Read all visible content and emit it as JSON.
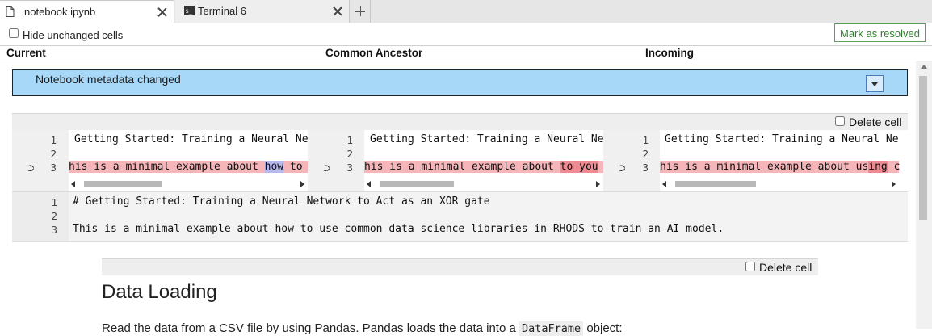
{
  "tabs": [
    {
      "label": "notebook.ipynb",
      "icon": "notebook-file-icon",
      "active": true
    },
    {
      "label": "Terminal 6",
      "icon": "terminal-icon",
      "active": false
    }
  ],
  "toolbar": {
    "hide_unchanged_label": "Hide unchanged cells",
    "mark_resolved_label": "Mark as resolved"
  },
  "columns": {
    "current": "Current",
    "ancestor": "Common Ancestor",
    "incoming": "Incoming"
  },
  "metadata_banner": {
    "text": "Notebook metadata changed"
  },
  "cell1": {
    "delete_label": "Delete cell",
    "panes": [
      {
        "line1": "Getting Started: Training a Neural Ne",
        "line3_pre": "his is a minimal example about ",
        "line3_hl": "how",
        "line3_post": " to"
      },
      {
        "line1": "Getting Started: Training a Neural Ne",
        "line3_pre": "his is a minimal example about ",
        "line3_hl": "to you",
        "line3_post": ""
      },
      {
        "line1": "Getting Started: Training a Neural Ne",
        "line3_pre": "his is a minimal example about us",
        "line3_hl": "ing",
        "line3_post": " c"
      }
    ],
    "merged": {
      "line1": "# Getting Started: Training a Neural Network to Act as an XOR gate",
      "line3": "This is a minimal example about how to use common data science libraries in RHODS to train an AI model."
    },
    "line_numbers": [
      "1",
      "2",
      "3"
    ]
  },
  "cell2": {
    "delete_label": "Delete cell",
    "heading": "Data Loading",
    "para_pre": "Read the data from a CSV file by using Pandas. Pandas loads the data into a ",
    "para_code": "DataFrame",
    "para_post": " object:"
  },
  "colors": {
    "metadata_banner": "#a8d8f8",
    "removed_line": "#f5b5b9",
    "resolve_green": "#2f7f2f"
  }
}
